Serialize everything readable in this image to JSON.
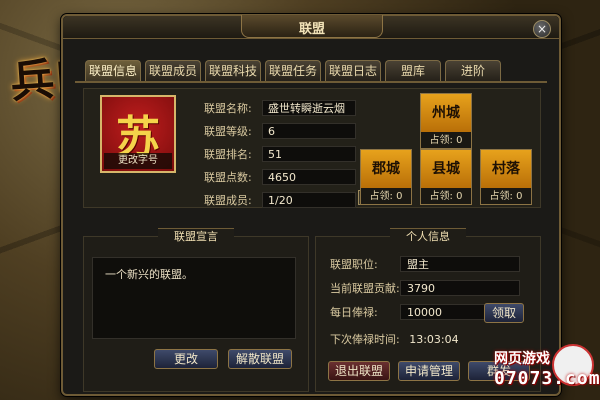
{
  "logo": {
    "text": "兵临城下"
  },
  "dialog": {
    "title": "联盟",
    "close_label": "×"
  },
  "tabs": [
    "联盟信息",
    "联盟成员",
    "联盟科技",
    "联盟任务",
    "联盟日志",
    "盟库",
    "进阶"
  ],
  "emblem": {
    "char": "苏",
    "button": "更改字号"
  },
  "alliance_info": {
    "name_label": "联盟名称:",
    "name": "盛世转瞬逝云烟",
    "level_label": "联盟等级:",
    "level": "6",
    "rank_label": "联盟排名:",
    "rank": "51",
    "points_label": "联盟点数:",
    "points": "4650",
    "members_label": "联盟成员:",
    "members": "1/20",
    "plus": "+"
  },
  "territories": [
    {
      "name": "州城",
      "count_label": "占领:",
      "count": "0"
    },
    {
      "name": "郡城",
      "count_label": "占领:",
      "count": "0"
    },
    {
      "name": "县城",
      "count_label": "占领:",
      "count": "0"
    },
    {
      "name": "村落",
      "count_label": "占领:",
      "count": "0"
    }
  ],
  "declaration": {
    "title": "联盟宣言",
    "text": "一个新兴的联盟。",
    "edit_button": "更改",
    "disband_button": "解散联盟"
  },
  "personal": {
    "title": "个人信息",
    "position_label": "联盟职位:",
    "position": "盟主",
    "contribution_label": "当前联盟贡献:",
    "contribution": "3790",
    "salary_label": "每日俸禄:",
    "salary": "10000",
    "claim_button": "领取",
    "next_label": "下次俸禄时间:",
    "next_time": "13:03:04",
    "leave_button": "退出联盟",
    "apply_button": "申请管理",
    "mass_button": "群发"
  },
  "watermark": {
    "top": "网页游戏",
    "bottom": "07073.com"
  },
  "colors": {
    "accent": "#e7a21c",
    "emblem_red": "#c01e1e",
    "panel_border": "#6e5b36"
  }
}
